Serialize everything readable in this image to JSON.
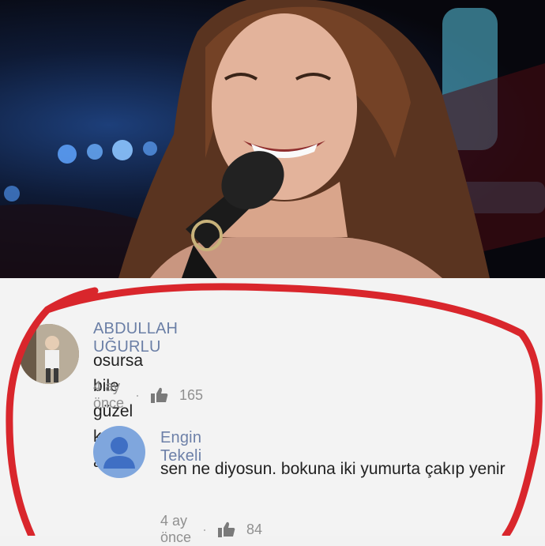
{
  "photo": {
    "description_icon": "singer-with-microphone-photo"
  },
  "comments": [
    {
      "author": "ABDULLAH UĞURLU",
      "text": "osursa bile güzel kokar aq",
      "time": "4 ay önce",
      "likes": "165",
      "avatar_icon": "user-photo-avatar"
    },
    {
      "author": "Engin Tekeli",
      "text": "sen ne diyosun. bokuna iki yumurta çakıp yenir",
      "time": "4 ay önce",
      "likes": "84",
      "avatar_icon": "default-user-avatar"
    }
  ],
  "colors": {
    "author": "#6b7fa6",
    "meta": "#909090",
    "ring": "#d9262c",
    "avatar_default": "#7fa6dd"
  }
}
